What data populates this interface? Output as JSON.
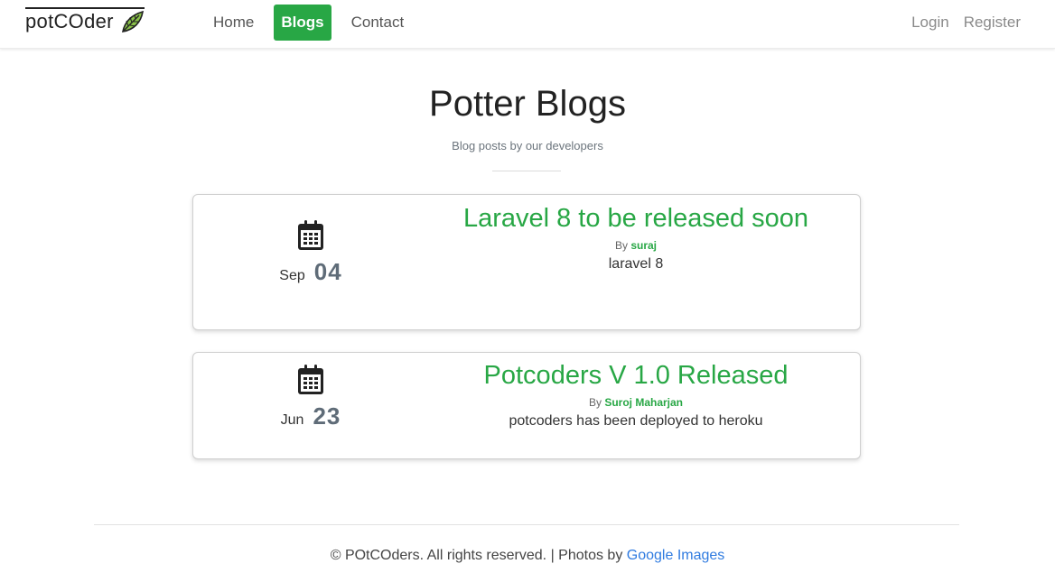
{
  "brand": {
    "name": "potCOder",
    "icon": "leaf-icon",
    "accent": "#28a745"
  },
  "nav": {
    "links": [
      {
        "label": "Home",
        "active": false
      },
      {
        "label": "Blogs",
        "active": true
      },
      {
        "label": "Contact",
        "active": false
      }
    ],
    "right": [
      {
        "label": "Login"
      },
      {
        "label": "Register"
      }
    ]
  },
  "header": {
    "title": "Potter Blogs",
    "subtitle": "Blog posts by our developers"
  },
  "posts": [
    {
      "month": "Sep",
      "day": "04",
      "title": "Laravel 8 to be released soon",
      "by_label": "By",
      "author": "suraj",
      "excerpt": "laravel 8",
      "icon": "calendar-icon"
    },
    {
      "month": "Jun",
      "day": "23",
      "title": "Potcoders V 1.0 Released",
      "by_label": "By",
      "author": "Suroj Maharjan",
      "excerpt": "potcoders has been deployed to heroku",
      "icon": "calendar-icon"
    }
  ],
  "footer": {
    "text": "© POtCOders. All rights reserved. | Photos by",
    "link_label": "Google Images",
    "link_color": "#2f7be0"
  }
}
